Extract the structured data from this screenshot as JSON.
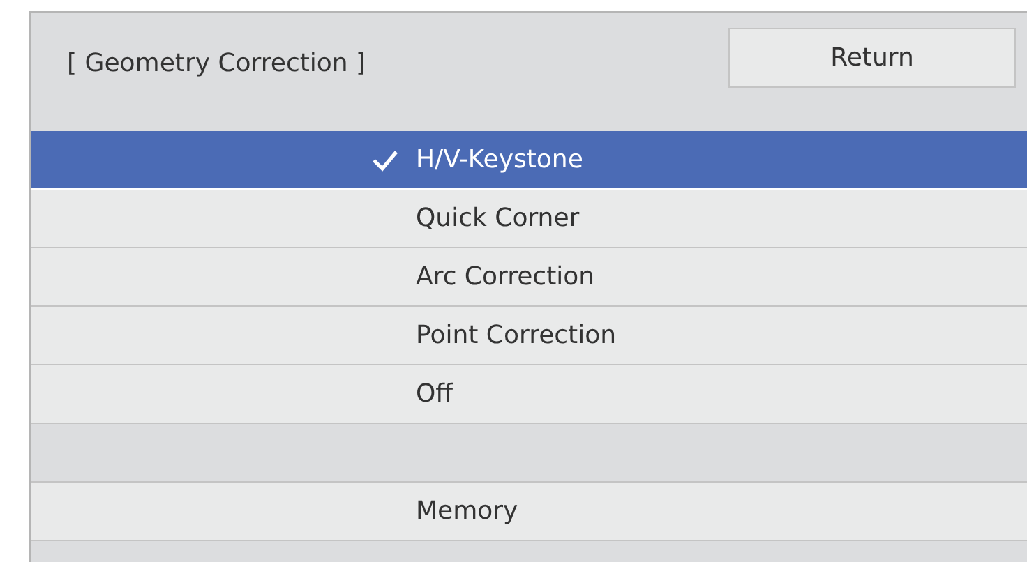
{
  "header": {
    "title": "[ Geometry Correction ]",
    "return_button": "Return"
  },
  "items": [
    {
      "kind": "option",
      "label": "H/V-Keystone",
      "selected": true
    },
    {
      "kind": "option",
      "label": "Quick Corner",
      "selected": false
    },
    {
      "kind": "option",
      "label": "Arc Correction",
      "selected": false
    },
    {
      "kind": "option",
      "label": "Point Correction",
      "selected": false
    },
    {
      "kind": "option",
      "label": "Off",
      "selected": false
    },
    {
      "kind": "spacer"
    },
    {
      "kind": "option",
      "label": "Memory",
      "selected": false
    },
    {
      "kind": "spacer"
    }
  ]
}
